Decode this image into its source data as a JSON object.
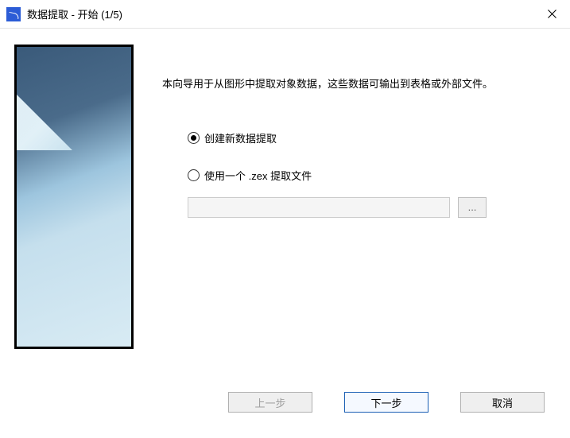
{
  "title": "数据提取 - 开始 (1/5)",
  "description": "本向导用于从图形中提取对象数据，这些数据可输出到表格或外部文件。",
  "options": {
    "create_new": "创建新数据提取",
    "use_existing": "使用一个 .zex 提取文件"
  },
  "file_path": "",
  "browse_label": "...",
  "buttons": {
    "back": "上一步",
    "next": "下一步",
    "cancel": "取消"
  }
}
